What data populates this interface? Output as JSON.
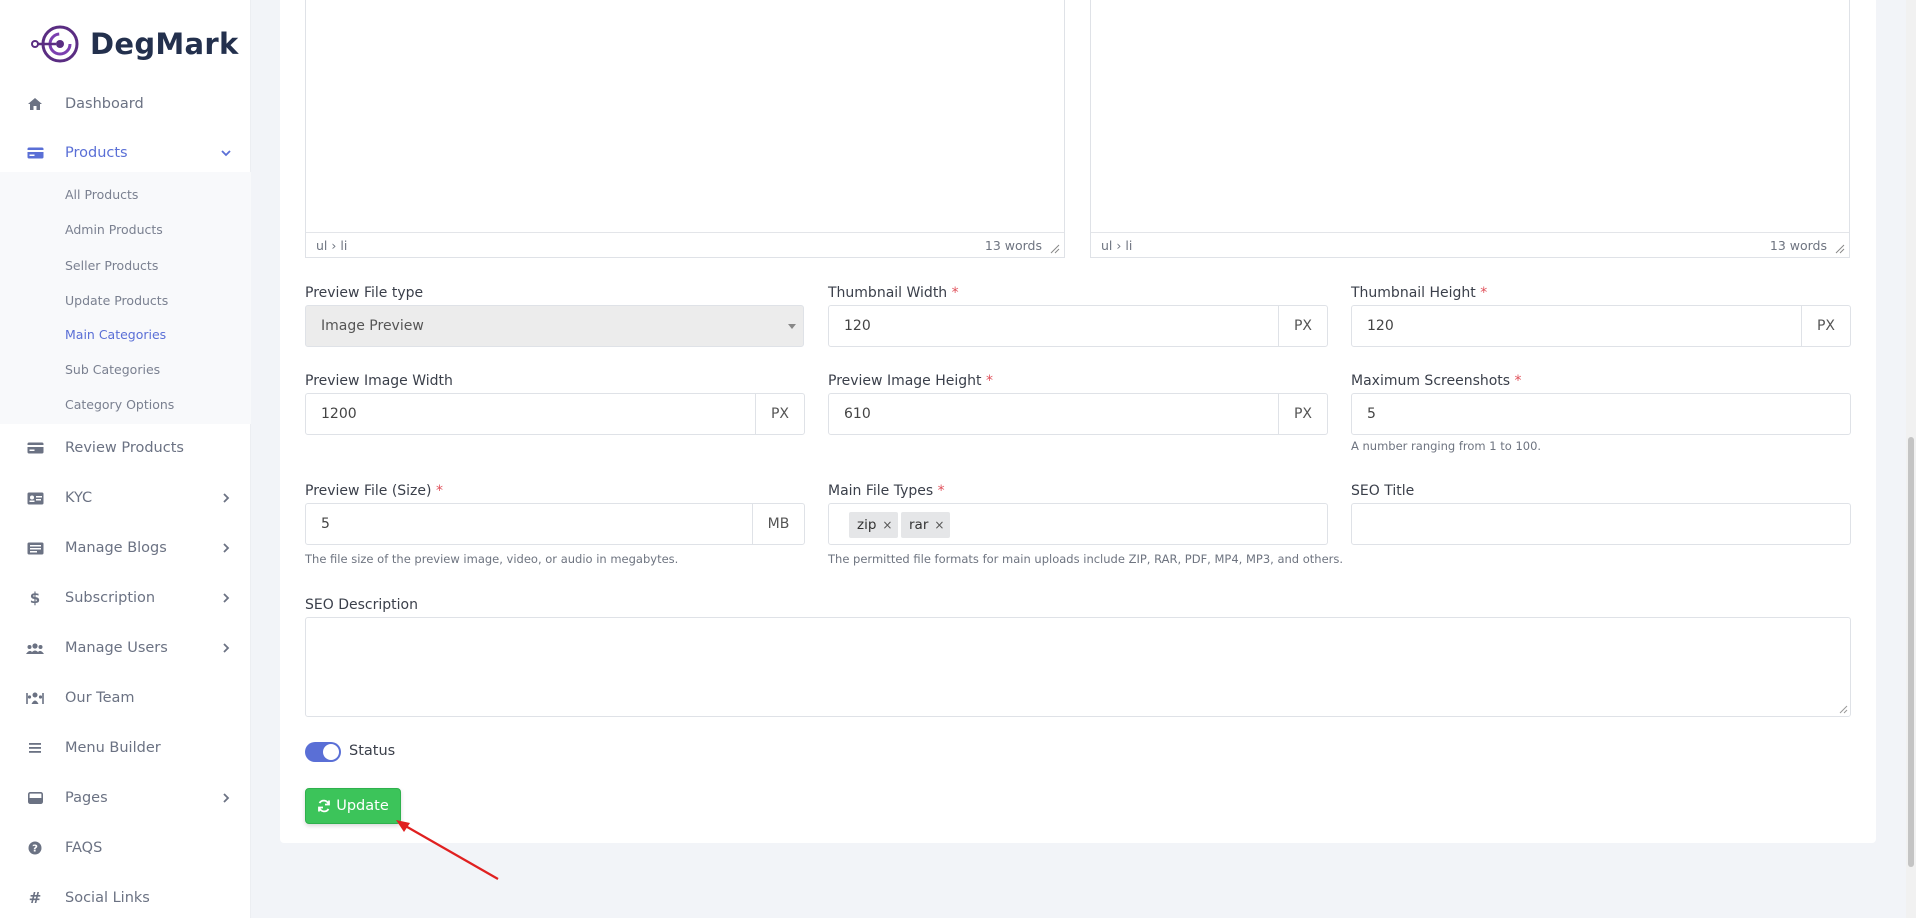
{
  "brand": {
    "name": "DegMark",
    "color": "#5a2d82"
  },
  "sidebar": {
    "items": [
      {
        "label": "Dashboard",
        "icon": "home-icon"
      },
      {
        "label": "Products",
        "icon": "card-icon"
      },
      {
        "label": "Review Products",
        "icon": "card-icon"
      },
      {
        "label": "KYC",
        "icon": "id-card-icon"
      },
      {
        "label": "Manage Blogs",
        "icon": "list-box-icon"
      },
      {
        "label": "Subscription",
        "icon": "dollar-icon"
      },
      {
        "label": "Manage Users",
        "icon": "users-icon"
      },
      {
        "label": "Our Team",
        "icon": "team-icon"
      },
      {
        "label": "Menu Builder",
        "icon": "bars-icon"
      },
      {
        "label": "Pages",
        "icon": "card-icon"
      },
      {
        "label": "FAQS",
        "icon": "question-icon"
      },
      {
        "label": "Social Links",
        "icon": "hash-icon"
      }
    ],
    "products_submenu": [
      "All Products",
      "Admin Products",
      "Seller Products",
      "Update Products",
      "Main Categories",
      "Sub Categories",
      "Category Options"
    ],
    "active_item": "Products",
    "active_subitem": "Main Categories"
  },
  "editors": {
    "left": {
      "path": "ul › li",
      "words": "13 words"
    },
    "right": {
      "path": "ul › li",
      "words": "13 words"
    }
  },
  "form": {
    "preview_file_type": {
      "label": "Preview File type",
      "value": "Image Preview"
    },
    "thumbnail_width": {
      "label": "Thumbnail Width",
      "value": "120",
      "unit": "PX",
      "required": "*"
    },
    "thumbnail_height": {
      "label": "Thumbnail Height",
      "value": "120",
      "unit": "PX",
      "required": "*"
    },
    "preview_image_width": {
      "label": "Preview Image Width",
      "value": "1200",
      "unit": "PX"
    },
    "preview_image_height": {
      "label": "Preview Image Height",
      "value": "610",
      "unit": "PX",
      "required": "*"
    },
    "maximum_screenshots": {
      "label": "Maximum Screenshots",
      "value": "5",
      "required": "*",
      "help": "A number ranging from 1 to 100."
    },
    "preview_file_size": {
      "label": "Preview File (Size)",
      "value": "5",
      "unit": "MB",
      "required": "*",
      "help": "The file size of the preview image, video, or audio in megabytes."
    },
    "main_file_types": {
      "label": "Main File Types",
      "required": "*",
      "tags": [
        "zip",
        "rar"
      ],
      "tag_remove": "×",
      "help": "The permitted file formats for main uploads include ZIP, RAR, PDF, MP4, MP3, and others."
    },
    "seo_title": {
      "label": "SEO Title",
      "value": ""
    },
    "seo_description": {
      "label": "SEO Description",
      "value": ""
    },
    "status": {
      "label": "Status",
      "on": true
    },
    "update_button": {
      "label": "Update"
    }
  },
  "colors": {
    "accent": "#5a6fd6",
    "success": "#3cc45a",
    "annotation_arrow": "#e02020"
  }
}
